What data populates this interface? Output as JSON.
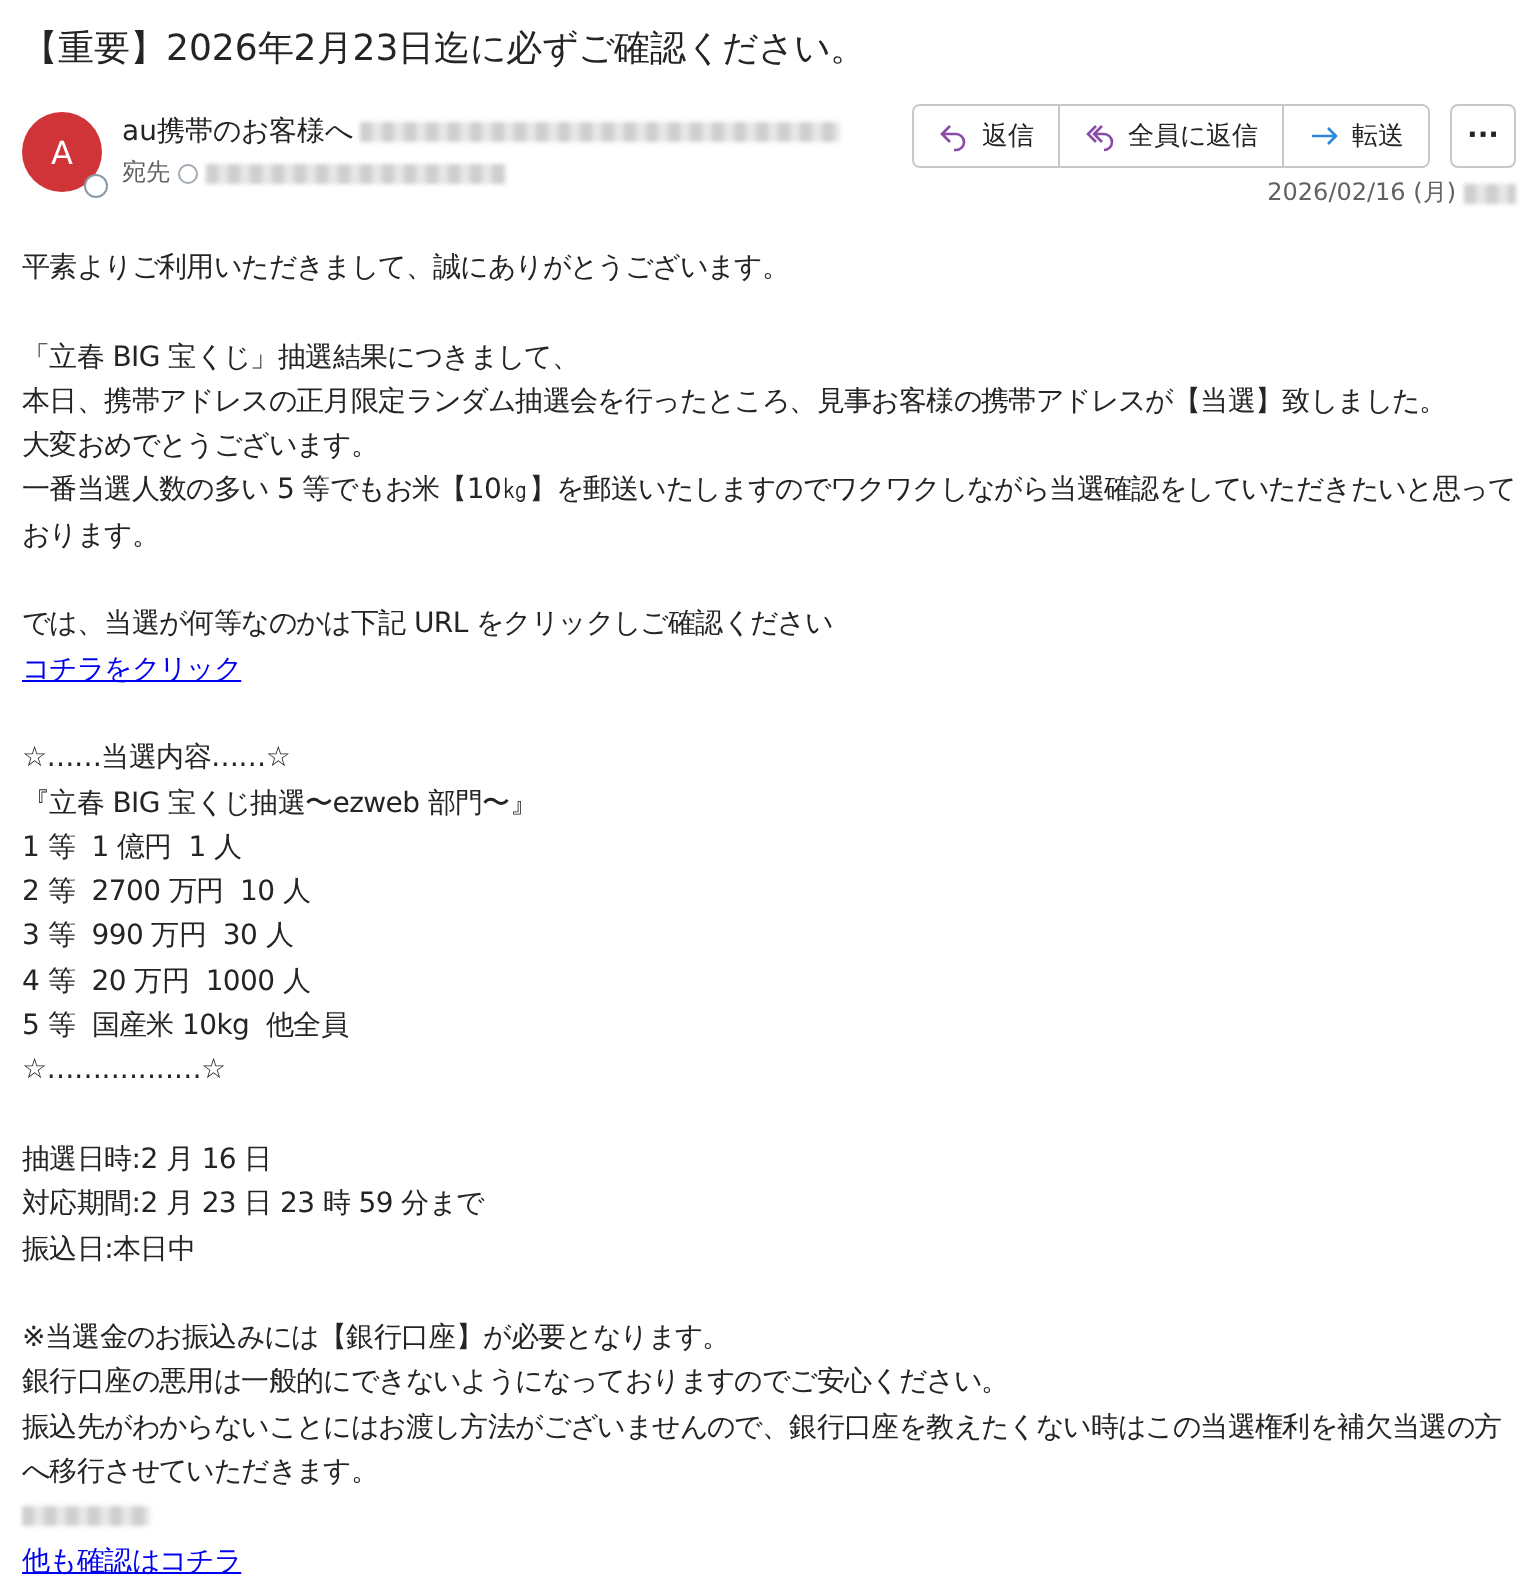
{
  "title": "【重要】2026年2月23日迄に必ずご確認ください。",
  "sender": {
    "avatar": "A",
    "name": "au携帯のお客様へ",
    "address_redacted": true,
    "to_label": "宛先",
    "recipient_redacted": true
  },
  "actions": [
    {
      "kind": "reply",
      "label": "返信"
    },
    {
      "kind": "reply_all",
      "label": "全員に返信"
    },
    {
      "kind": "forward",
      "label": "転送"
    }
  ],
  "more": "···",
  "date": "2026/02/16 (月)",
  "body": [
    [
      {
        "kind": "text",
        "text": "平素よりご利用いただきまして、誠にありがとうございます。"
      }
    ],
    [
      {
        "kind": "text",
        "text": "「立春 BIG 宝くじ」抽選結果につきまして、"
      },
      {
        "kind": "text",
        "text": "本日、携帯アドレスの正月限定ランダム抽選会を行ったところ、見事お客様の携帯アドレスが【当選】致しました。"
      },
      {
        "kind": "text",
        "text": "大変おめでとうございます。"
      },
      {
        "kind": "text",
        "text": "一番当選人数の多い 5 等でもお米【10㎏】を郵送いたしますのでワクワクしながら当選確認をしていただきたいと思っております。"
      }
    ],
    [
      {
        "kind": "text",
        "text": "では、当選が何等なのかは下記 URL をクリックしご確認ください"
      },
      {
        "kind": "link",
        "text": "コチラをクリック"
      }
    ],
    [
      {
        "kind": "text",
        "text": "☆……当選内容……☆"
      },
      {
        "kind": "text",
        "text": "『立春 BIG 宝くじ抽選〜ezweb 部門〜』"
      },
      {
        "kind": "text",
        "text": "1 等  1 億円  1 人"
      },
      {
        "kind": "text",
        "text": "2 等  2700 万円  10 人"
      },
      {
        "kind": "text",
        "text": "3 等  990 万円  30 人"
      },
      {
        "kind": "text",
        "text": "4 等  20 万円  1000 人"
      },
      {
        "kind": "text",
        "text": "5 等  国産米 10kg  他全員"
      },
      {
        "kind": "text",
        "text": "☆……‥‥‥‥…☆"
      }
    ],
    [
      {
        "kind": "text",
        "text": "抽選日時:2 月 16 日"
      },
      {
        "kind": "text",
        "text": "対応期間:2 月 23 日 23 時 59 分まで"
      },
      {
        "kind": "text",
        "text": "振込日:本日中"
      }
    ],
    [
      {
        "kind": "text",
        "text": "※当選金のお振込みには【銀行口座】が必要となります。"
      },
      {
        "kind": "text",
        "text": "銀行口座の悪用は一般的にできないようになっておりますのでご安心ください。"
      },
      {
        "kind": "text",
        "text": "振込先がわからないことにはお渡し方法がございませんので、銀行口座を教えたくない時はこの当選権利を補欠当選の方へ移行させていただきます。"
      },
      {
        "kind": "redacted"
      },
      {
        "kind": "link",
        "text": "他も確認はコチラ"
      }
    ]
  ]
}
